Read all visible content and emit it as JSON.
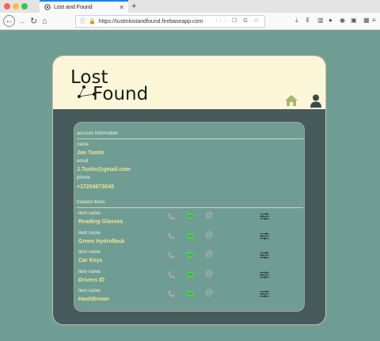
{
  "browser": {
    "tab_title": "Lost and Found",
    "url": "https://tustinlostandfound.firebaseapp.com",
    "url_icons": "··· ☐ G ☆"
  },
  "header": {
    "logo_lost": "Lost",
    "logo_found": "Found"
  },
  "account": {
    "section_title": "account information",
    "name_label": "name",
    "name_value": "Joe Tustin",
    "email_label": "email",
    "email_value": "J.Tustin@gmail.com",
    "phone_label": "phone",
    "phone_value": "+17204873045"
  },
  "tracked": {
    "section_title": "tracked items",
    "items": [
      {
        "label": "item name",
        "name": "Reading Glasses"
      },
      {
        "label": "item name",
        "name": "Green Hydroflask"
      },
      {
        "label": "item name",
        "name": "Car Keys"
      },
      {
        "label": "item name",
        "name": "Drivers ID"
      },
      {
        "label": "item name",
        "name": "HashBrown"
      }
    ]
  },
  "colors": {
    "background": "#6f9d93",
    "card": "#465b5b",
    "header": "#fcf6d9",
    "accent_text": "#f0e58a",
    "home_icon": "#a8b96b",
    "chat_icon": "#4fce4f"
  }
}
